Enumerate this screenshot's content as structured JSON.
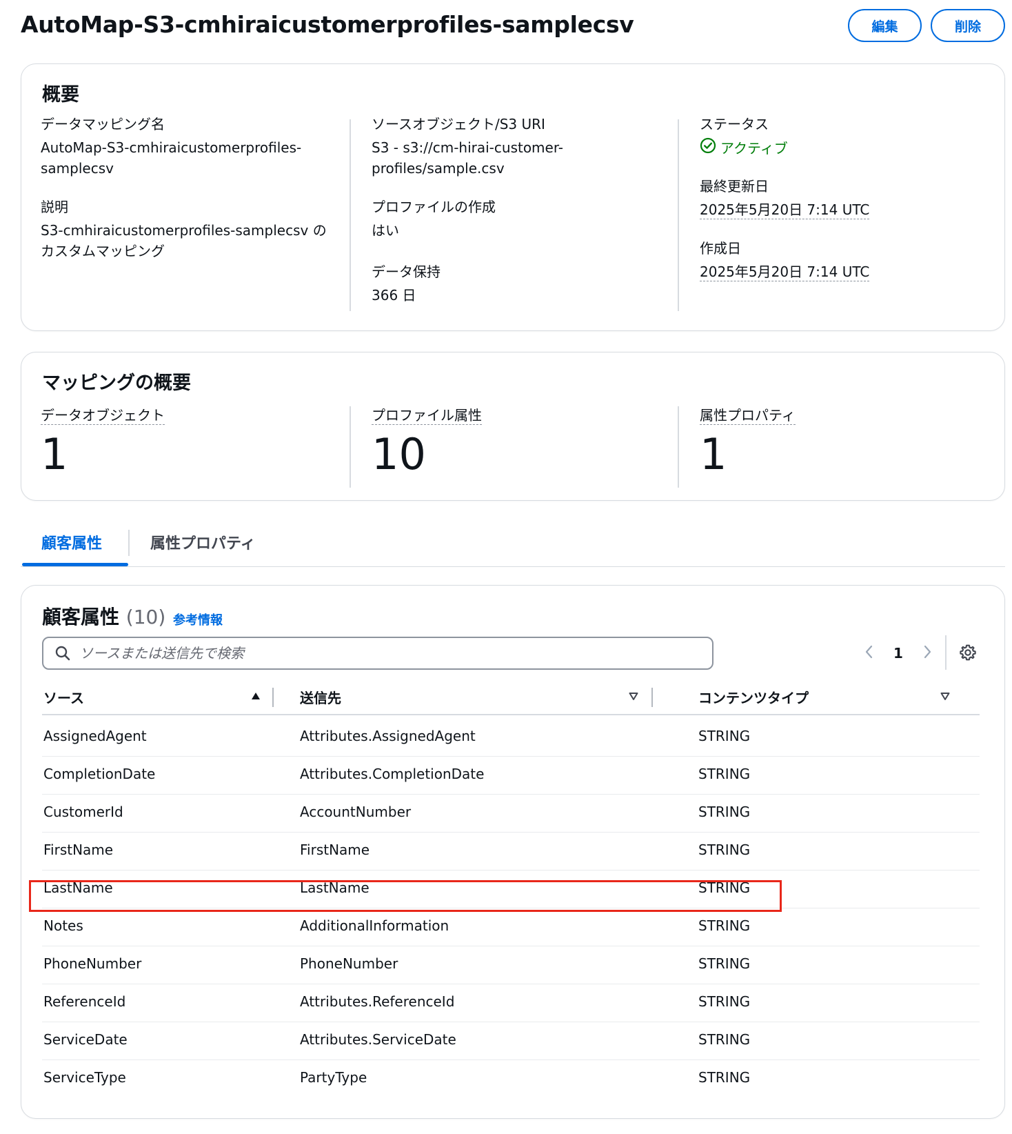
{
  "header": {
    "title": "AutoMap-S3-cmhiraicustomerprofiles-samplecsv",
    "edit_label": "編集",
    "delete_label": "削除"
  },
  "overview": {
    "title": "概要",
    "mapping_name_label": "データマッピング名",
    "mapping_name_line1": "AutoMap-S3-cmhiraicustomerprofiles-",
    "mapping_name_line2": "samplecsv",
    "description_label": "説明",
    "description_line1": "S3-cmhiraicustomerprofiles-samplecsv の",
    "description_line2": "カスタムマッピング",
    "source_label": "ソースオブジェクト/S3 URI",
    "source_line1": "S3 - s3://cm-hirai-customer-",
    "source_line2": "profiles/sample.csv",
    "profile_creation_label": "プロファイルの作成",
    "profile_creation_value": "はい",
    "retention_label": "データ保持",
    "retention_value": "366 日",
    "status_label": "ステータス",
    "status_value": "アクティブ",
    "status_color": "#037f0c",
    "last_updated_label": "最終更新日",
    "last_updated_value": "2025年5月20日 7:14 UTC",
    "created_label": "作成日",
    "created_value": "2025年5月20日 7:14 UTC"
  },
  "summary": {
    "title": "マッピングの概要",
    "metrics": [
      {
        "label": "データオブジェクト",
        "value": "1"
      },
      {
        "label": "プロファイル属性",
        "value": "10"
      },
      {
        "label": "属性プロパティ",
        "value": "1"
      }
    ]
  },
  "tabs": [
    {
      "label": "顧客属性",
      "active": true
    },
    {
      "label": "属性プロパティ",
      "active": false
    }
  ],
  "table": {
    "title": "顧客属性",
    "count": "(10)",
    "info_link": "参考情報",
    "search_placeholder": "ソースまたは送信先で検索",
    "page": "1",
    "columns": [
      "ソース",
      "送信先",
      "コンテンツタイプ"
    ],
    "rows": [
      {
        "source": "AssignedAgent",
        "destination": "Attributes.AssignedAgent",
        "type": "STRING"
      },
      {
        "source": "CompletionDate",
        "destination": "Attributes.CompletionDate",
        "type": "STRING"
      },
      {
        "source": "CustomerId",
        "destination": "AccountNumber",
        "type": "STRING"
      },
      {
        "source": "FirstName",
        "destination": "FirstName",
        "type": "STRING"
      },
      {
        "source": "LastName",
        "destination": "LastName",
        "type": "STRING"
      },
      {
        "source": "Notes",
        "destination": "AdditionalInformation",
        "type": "STRING"
      },
      {
        "source": "PhoneNumber",
        "destination": "PhoneNumber",
        "type": "STRING"
      },
      {
        "source": "ReferenceId",
        "destination": "Attributes.ReferenceId",
        "type": "STRING"
      },
      {
        "source": "ServiceDate",
        "destination": "Attributes.ServiceDate",
        "type": "STRING"
      },
      {
        "source": "ServiceType",
        "destination": "PartyType",
        "type": "STRING"
      }
    ],
    "highlight_color": "#e8271a"
  },
  "colors": {
    "accent": "#006ce0",
    "text": "#0f141a",
    "border": "#d7dbe0"
  }
}
